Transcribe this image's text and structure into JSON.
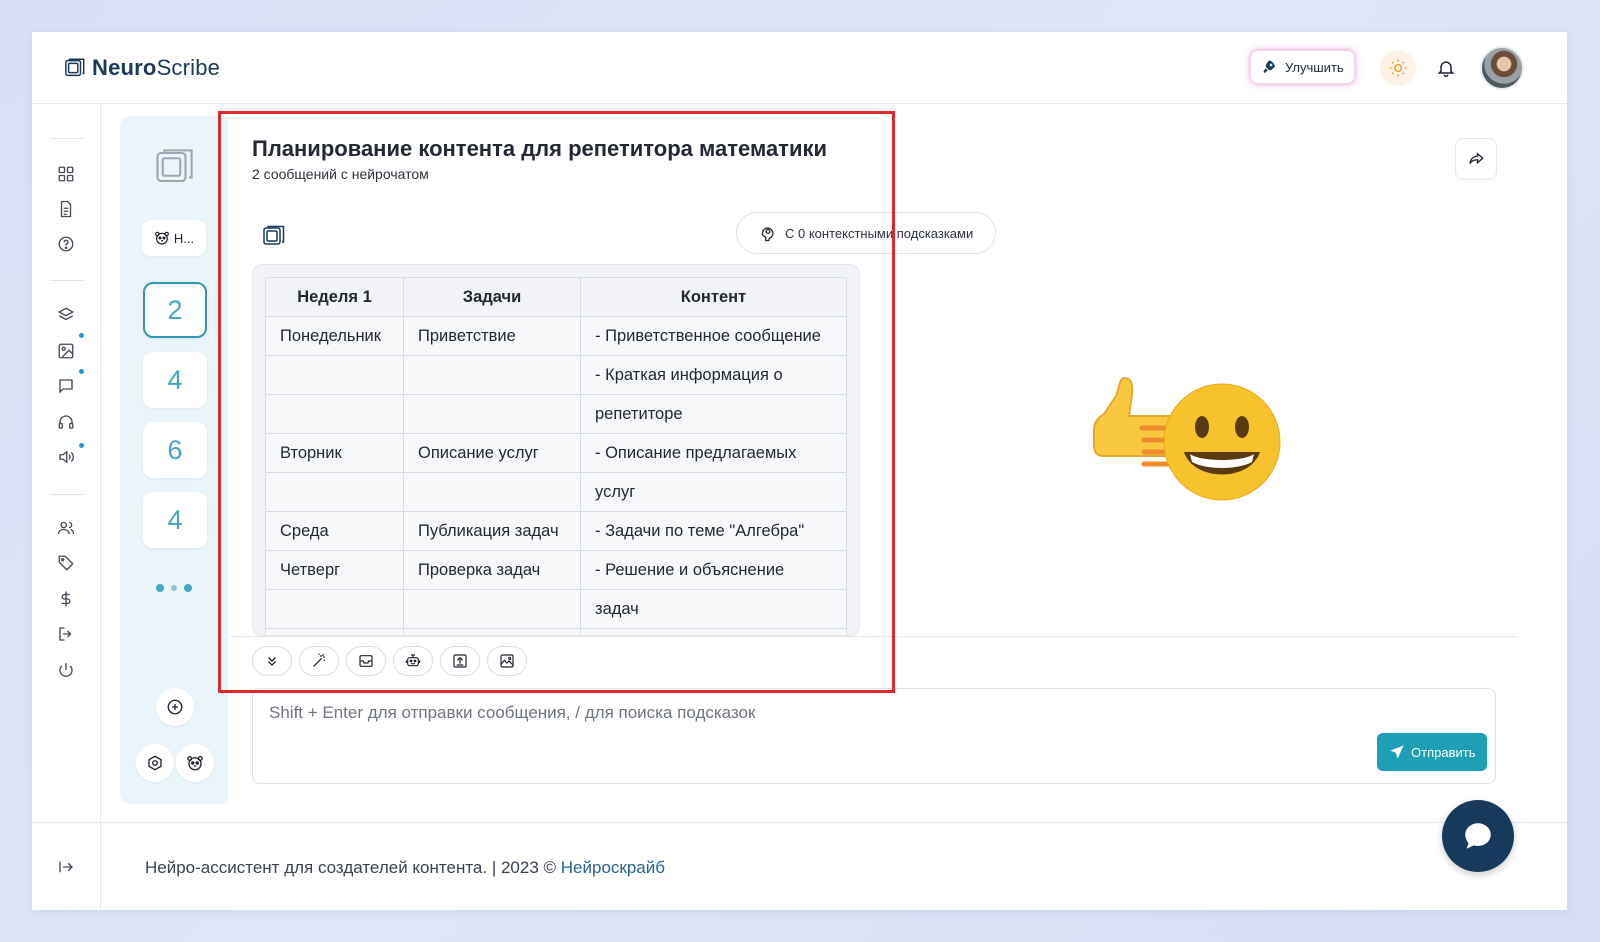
{
  "app": {
    "logo_bold": "Neuro",
    "logo_light": "Scribe"
  },
  "header": {
    "upgrade_label": "Улучшить"
  },
  "chat_list": {
    "chip_label": "Н...",
    "items": [
      "2",
      "4",
      "6",
      "4"
    ]
  },
  "chat": {
    "title": "Планирование контента для репетитора математики",
    "subtitle": "2 сообщений с нейрочатом",
    "context_pill": "С 0 контекстными подсказками",
    "table": {
      "headers": [
        "Неделя 1",
        "Задачи",
        "Контент"
      ],
      "rows": [
        [
          "Понедельник",
          "Приветствие",
          "- Приветственное сообщение"
        ],
        [
          "",
          "",
          "- Краткая информация о"
        ],
        [
          "",
          "",
          "репетиторе"
        ],
        [
          "Вторник",
          "Описание услуг",
          "- Описание предлагаемых"
        ],
        [
          "",
          "",
          "услуг"
        ],
        [
          "Среда",
          "Публикация задач",
          "- Задачи по теме \"Алгебра\""
        ],
        [
          "Четверг",
          "Проверка задач",
          "- Решение и объяснение"
        ],
        [
          "",
          "",
          "задач"
        ],
        [
          "",
          "",
          ""
        ]
      ]
    },
    "input_placeholder": "Shift + Enter для отправки сообщения, / для поиска подсказок",
    "send_label": "Отправить"
  },
  "footer": {
    "text": "Нейро-ассистент для создателей контента.  | 2023 ©",
    "link": "Нейроскрайб"
  },
  "colors": {
    "accent": "#1f9fb6",
    "brand_dark": "#17395c",
    "highlight": "#e0292d",
    "notification_dot": "#1c9ad6"
  }
}
